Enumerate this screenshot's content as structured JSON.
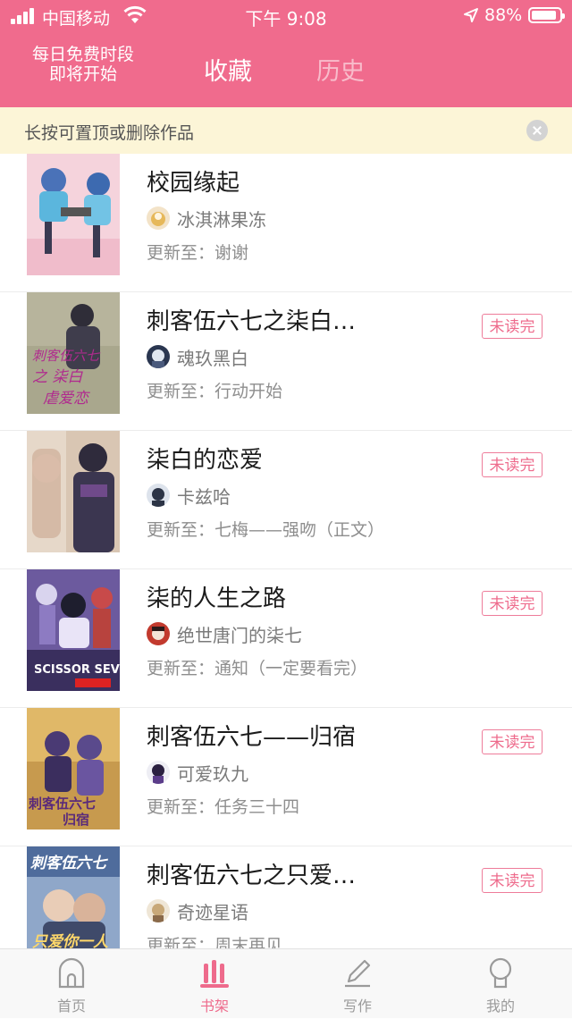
{
  "status_bar": {
    "carrier": "中国移动",
    "time": "下午 9:08",
    "battery": "88%"
  },
  "header": {
    "free_line1": "每日免费时段",
    "free_line2": "即将开始",
    "tabs": [
      {
        "label": "收藏",
        "active": true
      },
      {
        "label": "历史",
        "active": false
      }
    ]
  },
  "tip": {
    "text": "长按可置顶或删除作品"
  },
  "books": [
    {
      "title": "校园缘起",
      "author": "冰淇淋果冻",
      "update": "更新至：谢谢",
      "badge": ""
    },
    {
      "title": "刺客伍六七之柒白…",
      "author": "魂玖黑白",
      "update": "更新至：行动开始",
      "badge": "未读完"
    },
    {
      "title": "柒白的恋爱",
      "author": "卡兹哈",
      "update": "更新至：七梅——强吻（正文）",
      "badge": "未读完"
    },
    {
      "title": "柒的人生之路",
      "author": "绝世唐门的柒七",
      "update": "更新至：通知（一定要看完）",
      "badge": "未读完"
    },
    {
      "title": "刺客伍六七——归宿",
      "author": "可爱玖九",
      "update": "更新至：任务三十四",
      "badge": "未读完"
    },
    {
      "title": "刺客伍六七之只爱…",
      "author": "奇迹星语",
      "update": "更新至：周末再见",
      "badge": "未读完"
    }
  ],
  "tabbar": [
    {
      "label": "首页",
      "icon": "home-icon",
      "active": false
    },
    {
      "label": "书架",
      "icon": "bookshelf-icon",
      "active": true
    },
    {
      "label": "写作",
      "icon": "pencil-icon",
      "active": false
    },
    {
      "label": "我的",
      "icon": "profile-icon",
      "active": false
    }
  ],
  "colors": {
    "brand": "#f06b8d",
    "tip_bg": "#fcf5d7",
    "badge": "#ee6b8c"
  }
}
